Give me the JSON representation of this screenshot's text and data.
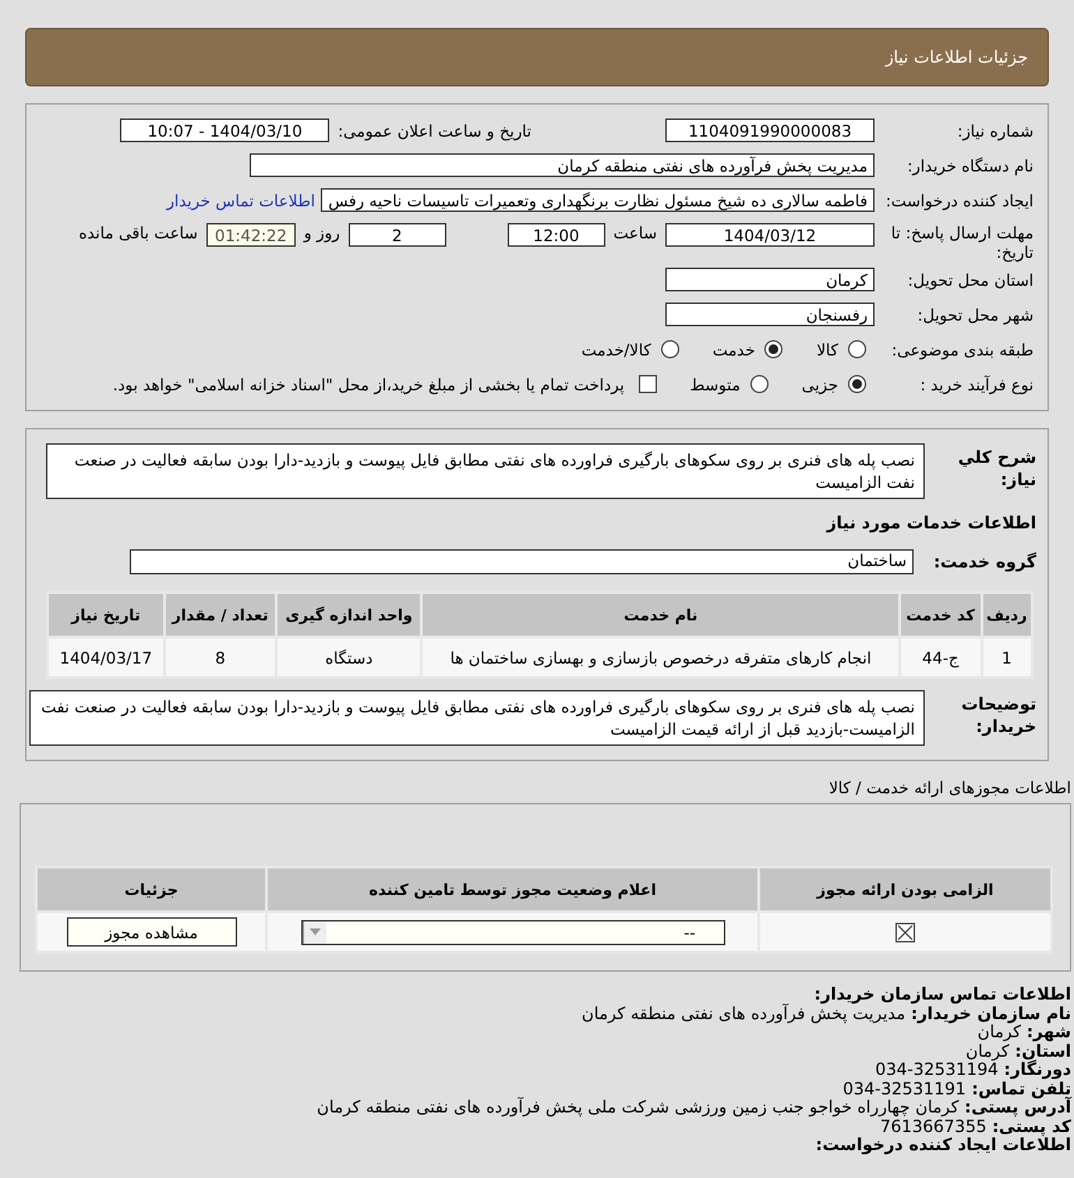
{
  "header": {
    "title": "جزئیات اطلاعات نیاز"
  },
  "need_info": {
    "need_number": {
      "label": "شماره نیاز:",
      "value": "1104091990000083"
    },
    "announce": {
      "label": "تاریخ و ساعت اعلان عمومی:",
      "value": "1404/03/10 - 10:07"
    },
    "buyer_org": {
      "label": "نام دستگاه خریدار:",
      "value": "مدیریت پخش فرآورده های نفتی منطقه کرمان"
    },
    "creator": {
      "label": "ایجاد کننده درخواست:",
      "value": "فاطمه سالاری ده شیخ مسئول نظارت برنگهداری وتعمیرات تاسیسات ناحیه رفس",
      "link": "اطلاعات تماس خریدار"
    },
    "deadline": {
      "label": "مهلت ارسال پاسخ: تا تاریخ:",
      "date": "1404/03/12",
      "time_label": "ساعت",
      "time": "12:00",
      "days": "2",
      "days_label": "روز و",
      "remaining": "01:42:22",
      "remaining_label": "ساعت باقی مانده"
    },
    "province": {
      "label": "استان محل تحویل:",
      "value": "کرمان"
    },
    "city": {
      "label": "شهر محل تحویل:",
      "value": "رفسنجان"
    },
    "category": {
      "label": "طبقه بندی موضوعی:",
      "options": [
        {
          "label": "کالا",
          "selected": false
        },
        {
          "label": "خدمت",
          "selected": true
        },
        {
          "label": "کالا/خدمت",
          "selected": false
        }
      ]
    },
    "process": {
      "label": "نوع فرآیند خرید :",
      "options": [
        {
          "label": "جزیی",
          "selected": true
        },
        {
          "label": "متوسط",
          "selected": false
        }
      ],
      "treasury": {
        "checked": false,
        "label": "پرداخت تمام یا بخشی از مبلغ خرید،از محل \"اسناد خزانه اسلامی\" خواهد بود."
      }
    }
  },
  "services": {
    "description": {
      "label": "شرح کلي نياز:",
      "value": "نصب پله های فنری بر روی سکوهای بارگیری فراورده های نفتی مطابق فایل پیوست و بازدید-دارا بودن سابقه فعالیت در صنعت نفت الزامیست"
    },
    "heading": "اطلاعات خدمات مورد نیاز",
    "group": {
      "label": "گروه خدمت:",
      "value": "ساختمان"
    },
    "table": {
      "columns": [
        "ردیف",
        "کد خدمت",
        "نام خدمت",
        "واحد اندازه گیری",
        "تعداد / مقدار",
        "تاریخ نیاز"
      ],
      "rows": [
        [
          "1",
          "ج-44",
          "انجام کارهای متفرقه درخصوص بازسازی و بهسازی ساختمان ها",
          "دستگاه",
          "8",
          "1404/03/17"
        ]
      ]
    },
    "buyer_notes": {
      "label": "توضیحات خریدار:",
      "value": "نصب پله های فنری بر روی سکوهای بارگیری فراورده های نفتی مطابق فایل پیوست و بازدید-دارا بودن سابقه فعالیت در صنعت نفت الزامیست-بازدید قبل از ارائه قیمت الزامیست"
    }
  },
  "permits": {
    "heading": "اطلاعات مجوزهای ارائه خدمت / کالا",
    "columns": [
      "الزامی بودن ارائه مجوز",
      "اعلام وضعیت مجوز توسط تامین کننده",
      "جزئیات"
    ],
    "rows": [
      {
        "required": true,
        "status": "--",
        "button": "مشاهده مجوز"
      }
    ]
  },
  "contact": [
    {
      "label": "اطلاعات تماس سازمان خریدار:"
    },
    {
      "label": "نام سازمان خریدار:",
      "value": "مدیریت پخش فرآورده های نفتی منطقه کرمان"
    },
    {
      "label": "شهر:",
      "value": "کرمان"
    },
    {
      "label": "استان:",
      "value": "کرمان"
    },
    {
      "label": "دورنگار:",
      "value": "034-32531194"
    },
    {
      "label": "تلفن تماس:",
      "value": "034-32531191"
    },
    {
      "label": "آدرس پستی:",
      "value": "کرمان چهارراه خواجو جنب زمین ورزشی شرکت ملی پخش فرآورده های نفتی منطقه کرمان"
    },
    {
      "label": "کد پستی:",
      "value": "7613667355"
    },
    {
      "label": "اطلاعات ایجاد کننده درخواست:"
    }
  ]
}
